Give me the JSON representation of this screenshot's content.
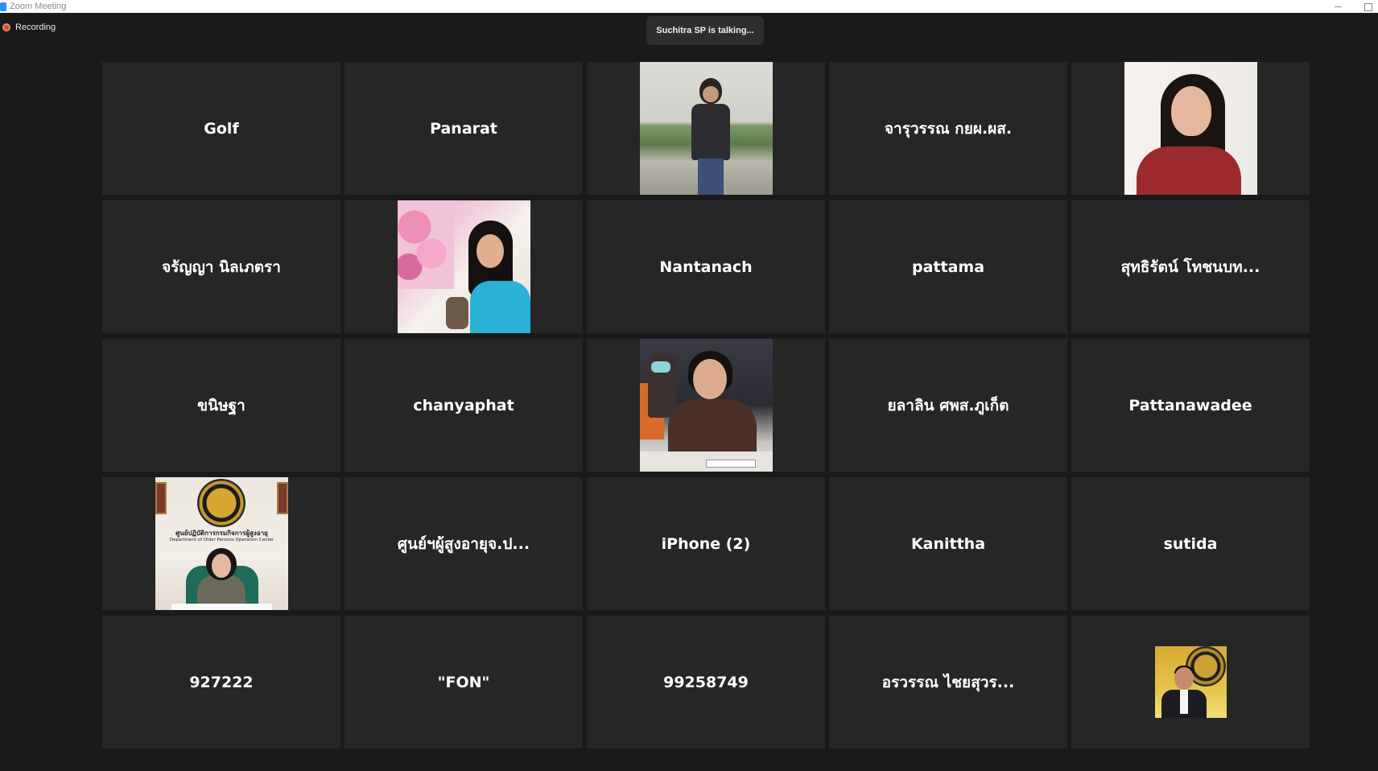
{
  "window": {
    "title": "Zoom Meeting"
  },
  "recording": {
    "label": "Recording"
  },
  "speaker": {
    "text": "Suchitra SP is talking..."
  },
  "participants": [
    {
      "name": "Golf"
    },
    {
      "name": "Panarat"
    },
    {
      "name": "",
      "photo": "person-standing-riverside"
    },
    {
      "name": "จารุวรรณ กยผ.ผส."
    },
    {
      "name": "",
      "photo": "woman-red-top"
    },
    {
      "name": "จรัญญา นิลเภตรา"
    },
    {
      "name": "",
      "photo": "woman-with-flowers"
    },
    {
      "name": "Nantanach"
    },
    {
      "name": "pattama"
    },
    {
      "name": "สุทธิรัตน์ โทชนบท..."
    },
    {
      "name": "ขนิษฐา"
    },
    {
      "name": "chanyaphat"
    },
    {
      "name": "",
      "photo": "woman-at-meeting-desk"
    },
    {
      "name": "ยลาลิน ศพส.ภูเก็ต"
    },
    {
      "name": "Pattanawadee"
    },
    {
      "name": "",
      "photo": "woman-office-seal",
      "sign_title": "ศูนย์ปฏิบัติการกรมกิจการผู้สูงอายุ",
      "sign_subtitle": "Department of Older Persons Operation Center"
    },
    {
      "name": "ศูนย์ฯผู้สูงอายุจ.ป..."
    },
    {
      "name": "iPhone (2)"
    },
    {
      "name": "Kanittha"
    },
    {
      "name": "sutida"
    },
    {
      "name": "927222"
    },
    {
      "name": "\"FON\""
    },
    {
      "name": "99258749"
    },
    {
      "name": "อรวรรณ ไชยสุวร..."
    },
    {
      "name": "",
      "photo": "man-gold-seal-background"
    }
  ],
  "colors": {
    "background": "#1a1a1a",
    "tile": "#262626",
    "recording_dot": "#e0442e",
    "speaker_bubble": "#2e2e2e"
  }
}
